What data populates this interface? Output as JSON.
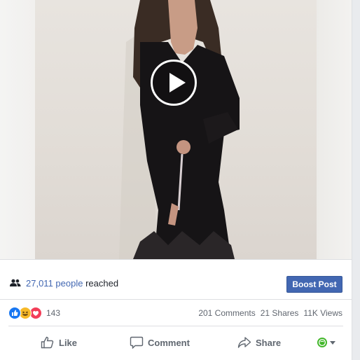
{
  "video": {
    "play_label": "Play video"
  },
  "reach": {
    "count_text": "27,011 people",
    "suffix_text": " reached"
  },
  "boost": {
    "label": "Boost Post"
  },
  "stats": {
    "reactions_count": "143",
    "comments": "201 Comments",
    "shares": "21 Shares",
    "views": "11K Views"
  },
  "actions": {
    "like": "Like",
    "comment": "Comment",
    "share": "Share"
  },
  "icons": {
    "reach": "people-icon",
    "reactions": [
      "like-reaction-icon",
      "haha-reaction-icon",
      "love-reaction-icon"
    ],
    "like": "thumbs-up-icon",
    "comment": "comment-bubble-icon",
    "share": "share-arrow-icon",
    "audience": "audience-selector-icon"
  },
  "colors": {
    "brand_blue": "#4267b2",
    "like_blue": "#1877f2",
    "love_red": "#f33e58",
    "haha_yellow": "#f7b928",
    "muted_text": "#616770",
    "audience_green": "#42b72a"
  }
}
